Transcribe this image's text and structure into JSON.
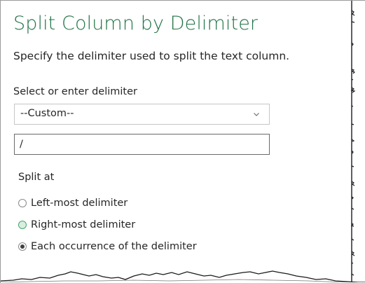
{
  "dialog": {
    "title": "Split Column by Delimiter",
    "description": "Specify the delimiter used to split the text column."
  },
  "delimiter": {
    "label": "Select or enter delimiter",
    "selected": "--Custom--",
    "custom_value": "/"
  },
  "split_at": {
    "label": "Split at",
    "options": [
      {
        "label": "Left-most delimiter",
        "state": "unchecked"
      },
      {
        "label": "Right-most delimiter",
        "state": "hover"
      },
      {
        "label": "Each occurrence of the delimiter",
        "state": "checked"
      }
    ]
  },
  "colors": {
    "title": "#217346",
    "text": "#262626",
    "hover_radio": "#d8efdf"
  },
  "icons": {
    "dropdown": "chevron-down-icon"
  }
}
